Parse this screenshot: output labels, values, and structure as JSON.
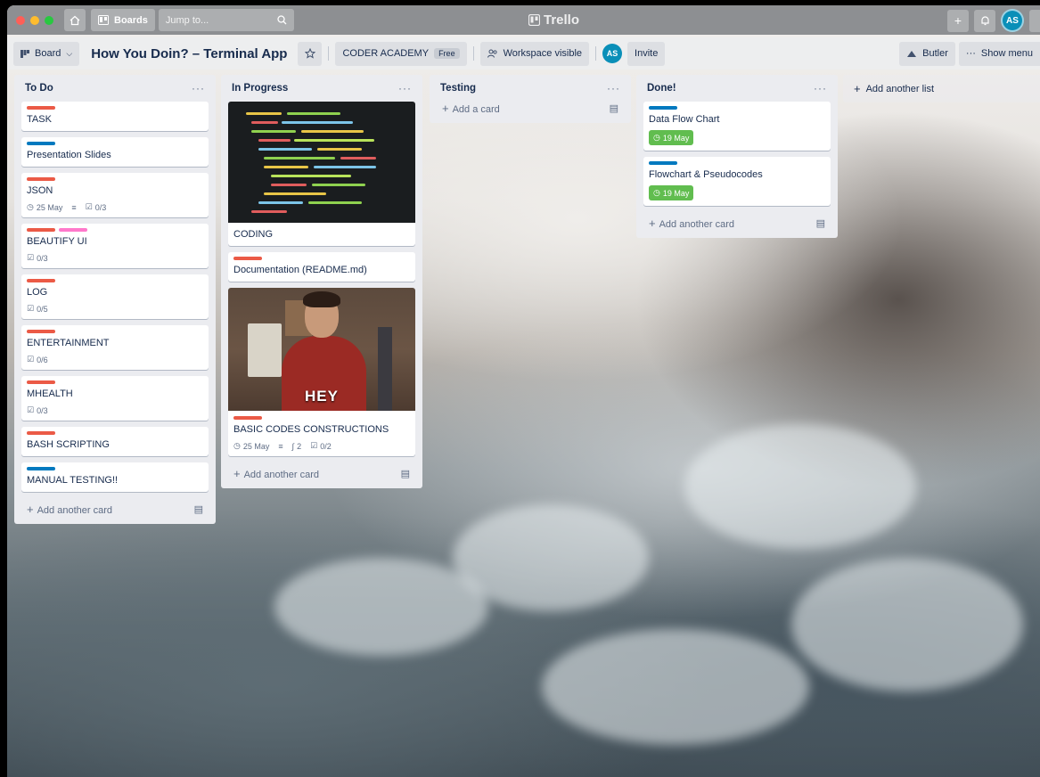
{
  "titlebar": {
    "boards_label": "Boards",
    "jump_placeholder": "Jump to...",
    "app_name": "Trello",
    "user_initials": "AS"
  },
  "boardbar": {
    "view_label": "Board",
    "title": "How You Doin? – Terminal App",
    "workspace": "CODER ACADEMY",
    "plan": "Free",
    "visibility": "Workspace visible",
    "member_initials": "AS",
    "invite_label": "Invite",
    "butler_label": "Butler",
    "menu_label": "Show menu"
  },
  "lists": [
    {
      "title": "To Do",
      "add_label": "Add another card",
      "cards": [
        {
          "title": "TASK"
        },
        {
          "title": "Presentation Slides"
        },
        {
          "title": "JSON",
          "due": "25 May",
          "checklist": "0/3"
        },
        {
          "title": "BEAUTIFY UI",
          "checklist": "0/3"
        },
        {
          "title": "LOG",
          "checklist": "0/5"
        },
        {
          "title": "ENTERTAINMENT",
          "checklist": "0/6"
        },
        {
          "title": "MHEALTH",
          "checklist": "0/3"
        },
        {
          "title": "BASH SCRIPTING"
        },
        {
          "title": "MANUAL TESTING!!"
        }
      ]
    },
    {
      "title": "In Progress",
      "add_label": "Add another card",
      "cards": [
        {
          "title": "CODING"
        },
        {
          "title": "Documentation (README.md)"
        },
        {
          "title": "BASIC CODES CONSTRUCTIONS",
          "cover_text": "HEY",
          "due": "25 May",
          "attachments": "2",
          "checklist": "0/2"
        }
      ]
    },
    {
      "title": "Testing",
      "add_label": "Add a card"
    },
    {
      "title": "Done!",
      "add_label": "Add another card",
      "cards": [
        {
          "title": "Data Flow Chart",
          "due": "19 May"
        },
        {
          "title": "Flowchart & Pseudocodes",
          "due": "19 May"
        }
      ]
    }
  ],
  "add_list_label": "Add another list",
  "colors": {
    "label_red": "#eb5a46",
    "label_blue": "#0079bf",
    "label_pink": "#ff78cb",
    "due_complete": "#61bd4f",
    "list_bg": "#ebecf0"
  }
}
